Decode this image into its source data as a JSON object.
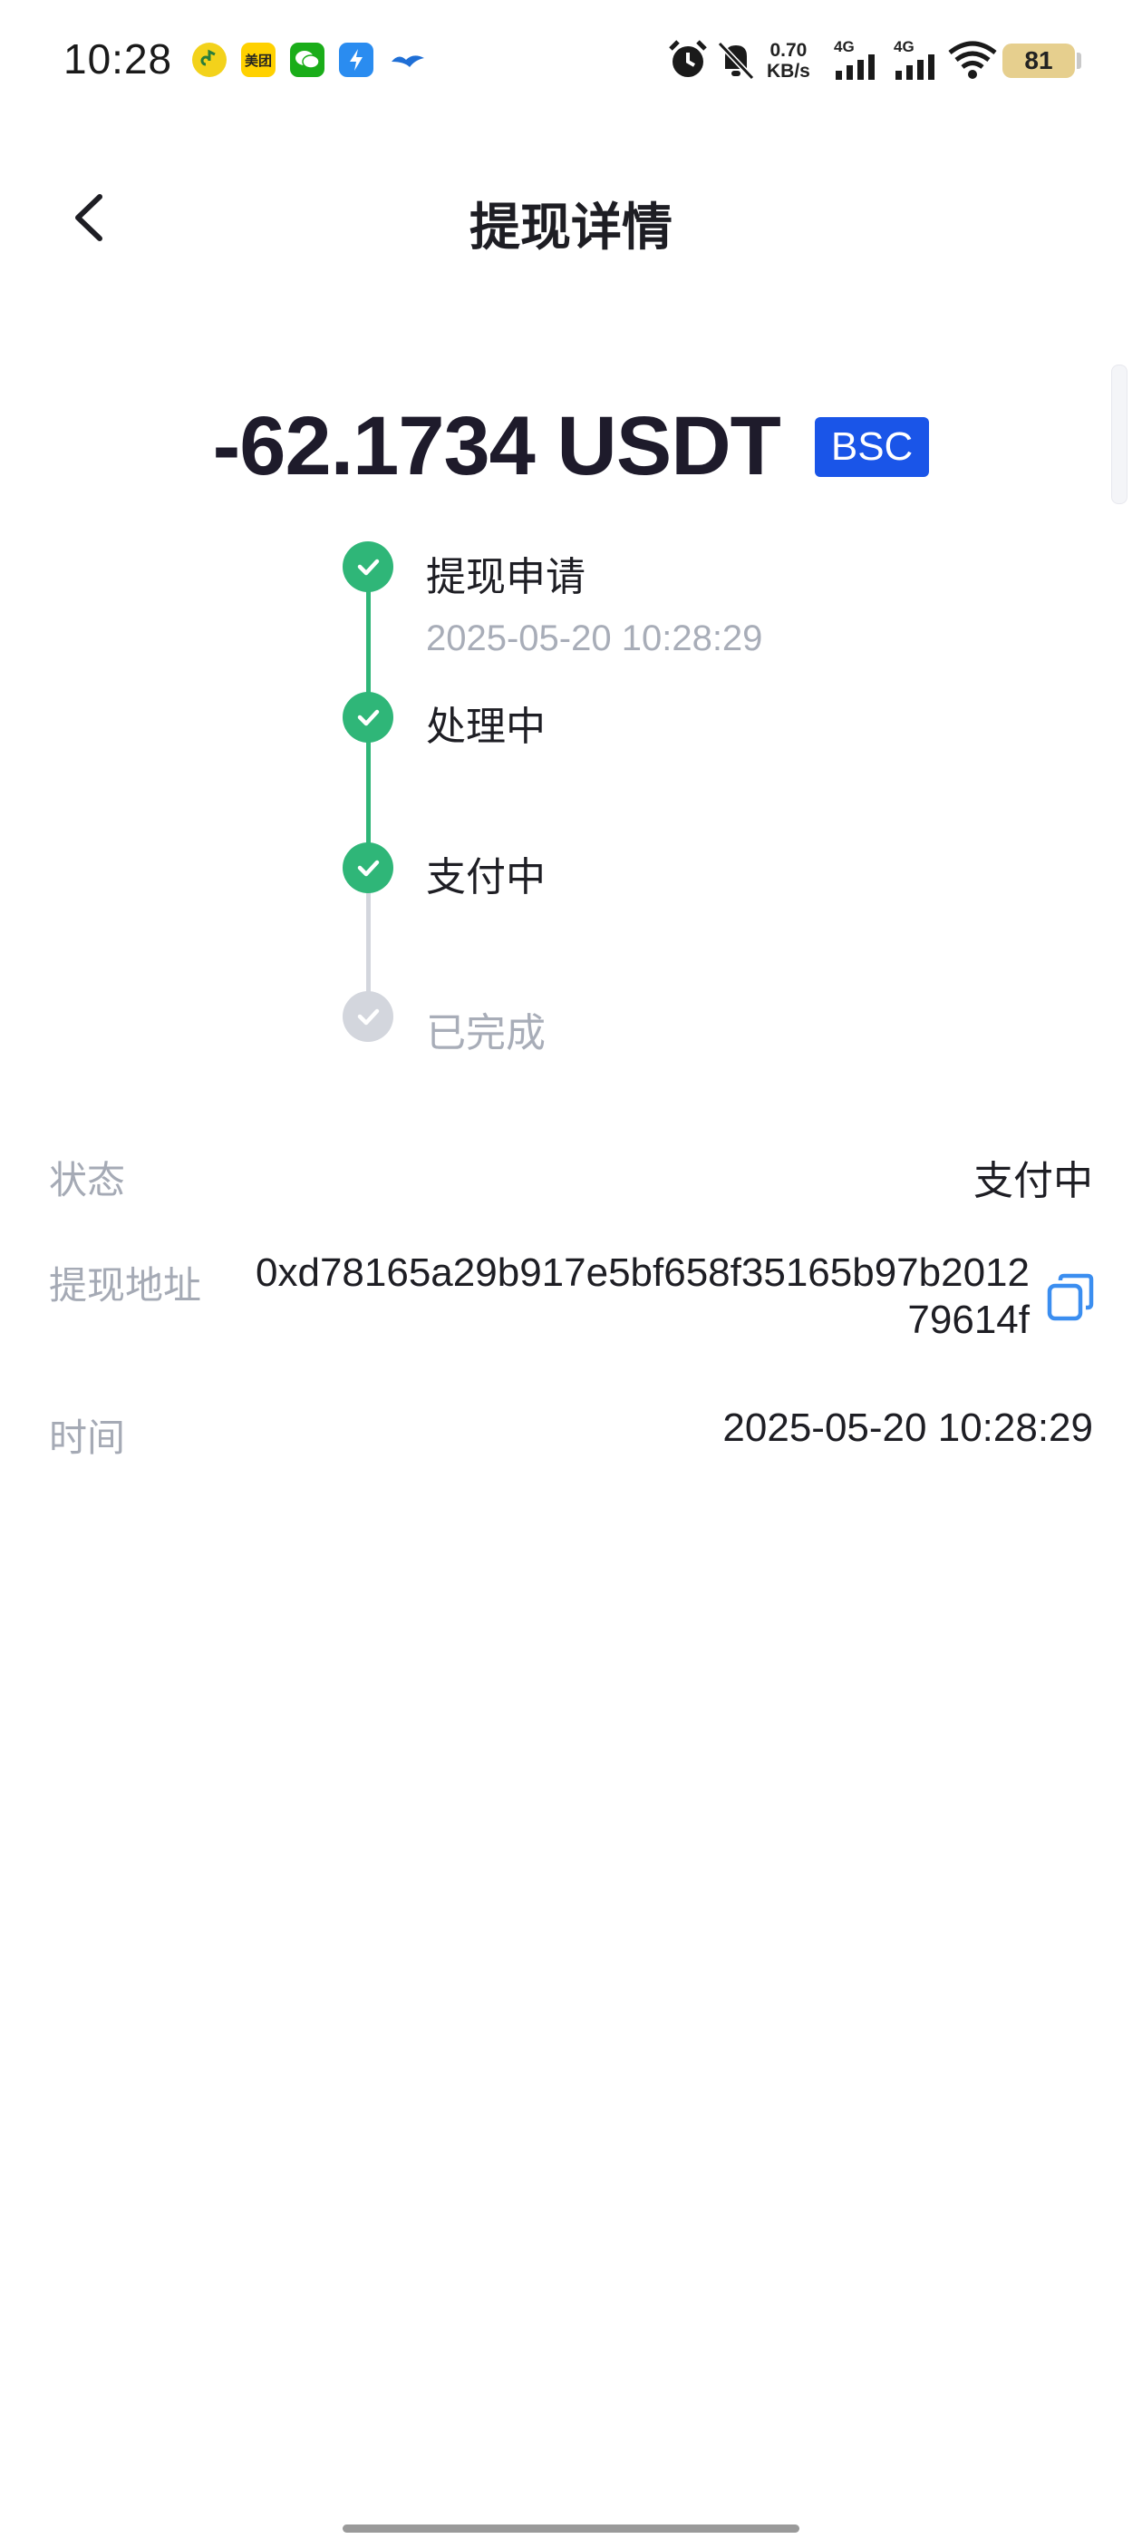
{
  "status_bar": {
    "time": "10:28",
    "apps": [
      {
        "icon": "music-app-icon",
        "color": "#f3d21b"
      },
      {
        "icon": "meituan-app-icon",
        "label": "美团",
        "color": "#ffd100"
      },
      {
        "icon": "wechat-app-icon",
        "color": "#1aad19"
      },
      {
        "icon": "lightning-app-icon",
        "color": "#2a8cf0"
      },
      {
        "icon": "bird-app-icon",
        "color": "#1f6fd6"
      }
    ],
    "net_speed_value": "0.70",
    "net_speed_unit": "KB/s",
    "signal1_label": "4G",
    "signal2_label": "4G",
    "battery": "81"
  },
  "header": {
    "title": "提现详情",
    "back_icon": "chevron-left-icon"
  },
  "amount": {
    "value": "-62.1734 USDT",
    "chain": "BSC"
  },
  "timeline": [
    {
      "label": "提现申请",
      "time": "2025-05-20 10:28:29",
      "state": "done"
    },
    {
      "label": "处理中",
      "state": "done"
    },
    {
      "label": "支付中",
      "state": "done"
    },
    {
      "label": "已完成",
      "state": "pending"
    }
  ],
  "details": {
    "status_label": "状态",
    "status_value": "支付中",
    "address_label": "提现地址",
    "address_value": "0xd78165a29b917e5bf658f35165b97b201279614f",
    "time_label": "时间",
    "time_value": "2025-05-20 10:28:29"
  },
  "colors": {
    "accent_green": "#2fb678",
    "pending_gray": "#d3d6dd",
    "chain_blue": "#1a55e8",
    "copy_blue": "#3b8ef0"
  }
}
